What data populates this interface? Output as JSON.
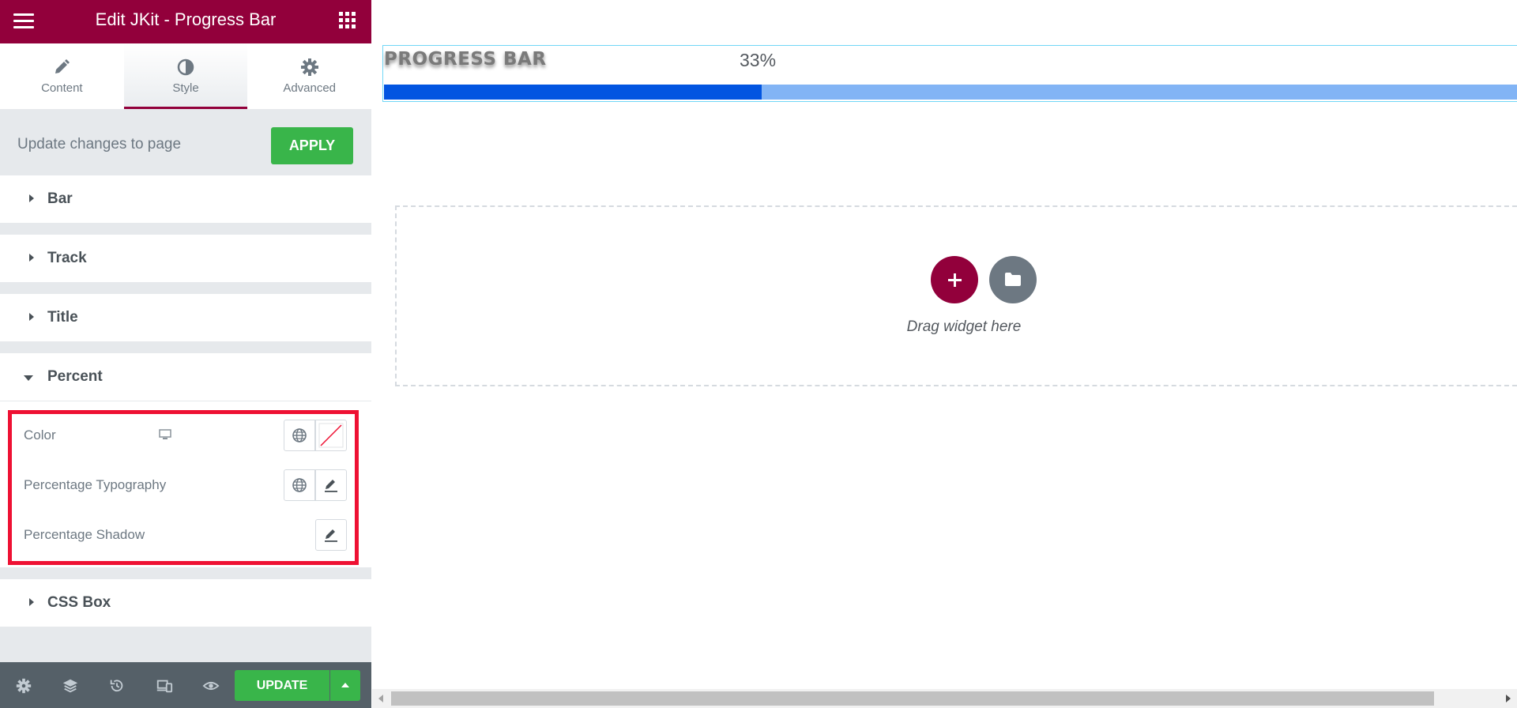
{
  "window": {
    "title": "Edit JKit - Progress Bar"
  },
  "tabs": [
    {
      "label": "Content",
      "icon": "pencil-icon"
    },
    {
      "label": "Style",
      "icon": "half-circle-icon",
      "active": true
    },
    {
      "label": "Advanced",
      "icon": "gear-icon"
    }
  ],
  "update_notice": {
    "message": "Update changes to page",
    "apply_label": "APPLY"
  },
  "sections": {
    "bar": "Bar",
    "track": "Track",
    "title": "Title",
    "percent": "Percent",
    "css_box": "CSS Box"
  },
  "percent_controls": {
    "color_label": "Color",
    "typography_label": "Percentage Typography",
    "shadow_label": "Percentage Shadow"
  },
  "footer": {
    "update_label": "UPDATE"
  },
  "canvas": {
    "progress_title": "PROGRESS BAR",
    "progress_percent_text": "33%",
    "progress_fraction": 0.33,
    "drop_text": "Drag widget here"
  },
  "colors": {
    "brand": "#92003b",
    "apply_green": "#39b54a",
    "highlight": "#ee1133",
    "bar_fill": "#0255e1",
    "track_fill": "#82b4f5"
  }
}
